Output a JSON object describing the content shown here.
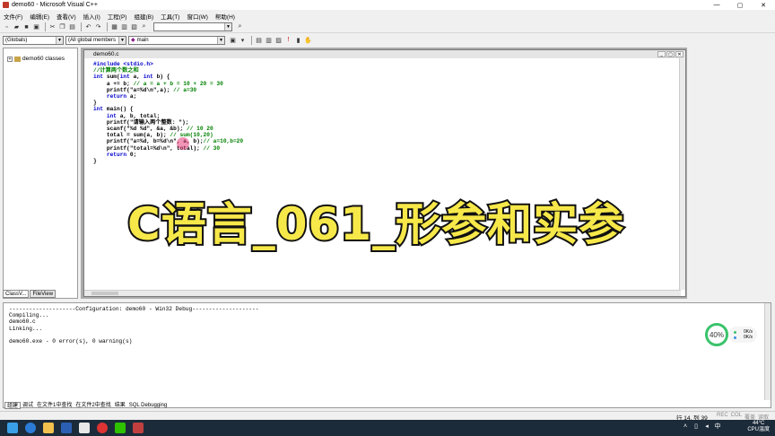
{
  "window": {
    "title": "demo60 - Microsoft Visual C++",
    "min": "—",
    "max": "▢",
    "close": "✕"
  },
  "menu": [
    "文件(F)",
    "编辑(E)",
    "查看(V)",
    "插入(I)",
    "工程(P)",
    "组建(B)",
    "工具(T)",
    "窗口(W)",
    "帮助(H)"
  ],
  "toolbar2": {
    "scope": "(Globals)",
    "members": "(All global members",
    "function": "main"
  },
  "leftpane": {
    "tree_root": "demo60 classes",
    "tabs": [
      "ClassV...",
      "FileView"
    ]
  },
  "editor": {
    "tab_title": "demo60.c",
    "lines": [
      [
        {
          "t": "#include <stdio.h>",
          "c": "kw"
        }
      ],
      [
        {
          "t": "//计算两个数之和",
          "c": "cm"
        }
      ],
      [
        {
          "t": "int ",
          "c": "kw"
        },
        {
          "t": "sum(",
          "c": "tx"
        },
        {
          "t": "int ",
          "c": "kw"
        },
        {
          "t": "a, ",
          "c": "tx"
        },
        {
          "t": "int ",
          "c": "kw"
        },
        {
          "t": "b) {",
          "c": "tx"
        }
      ],
      [
        {
          "t": "    a += b; ",
          "c": "tx"
        },
        {
          "t": "// a = a + b = 10 + 20 = 30",
          "c": "cm"
        }
      ],
      [
        {
          "t": "    printf(\"a=%d\\n\",a); ",
          "c": "tx"
        },
        {
          "t": "// a=30",
          "c": "cm"
        }
      ],
      [
        {
          "t": "    ",
          "c": "tx"
        },
        {
          "t": "return ",
          "c": "kw"
        },
        {
          "t": "a;",
          "c": "tx"
        }
      ],
      [
        {
          "t": "}",
          "c": "tx"
        }
      ],
      [
        {
          "t": "int ",
          "c": "kw"
        },
        {
          "t": "main() {",
          "c": "tx"
        }
      ],
      [
        {
          "t": "    ",
          "c": "tx"
        },
        {
          "t": "int ",
          "c": "kw"
        },
        {
          "t": "a, b, total;",
          "c": "tx"
        }
      ],
      [
        {
          "t": "    printf(\"请输入两个整数: \");",
          "c": "tx"
        }
      ],
      [
        {
          "t": "    scanf(\"%d %d\", &a, &b); ",
          "c": "tx"
        },
        {
          "t": "// 10 20",
          "c": "cm"
        }
      ],
      [
        {
          "t": "    total = sum(a, b); ",
          "c": "tx"
        },
        {
          "t": "// sum(10,20)",
          "c": "cm"
        }
      ],
      [
        {
          "t": "    printf(\"a=%d, b=%d\\n\", a, b);",
          "c": "tx"
        },
        {
          "t": "// a=10,b=20",
          "c": "cm"
        }
      ],
      [
        {
          "t": "    printf(\"total=%d\\n\", total); ",
          "c": "tx"
        },
        {
          "t": "// 30",
          "c": "cm"
        }
      ],
      [
        {
          "t": "    ",
          "c": "tx"
        },
        {
          "t": "return ",
          "c": "kw"
        },
        {
          "t": "0;",
          "c": "tx"
        }
      ],
      [
        {
          "t": "}",
          "c": "tx"
        }
      ]
    ]
  },
  "overlay_title": "C语言_061_形参和实参",
  "output": {
    "text": "--------------------Configuration: demo60 - Win32 Debug--------------------\nCompiling...\ndemo60.c\nLinking...\n\ndemo60.exe - 0 error(s), 0 warning(s)",
    "tabs": [
      "组建",
      "调试",
      "在文件1中查找",
      "在文件2中查找",
      "结果",
      "SQL Debugging"
    ]
  },
  "status": {
    "position": "行 14, 列 39",
    "flags": [
      "REC",
      "COL",
      "覆盖",
      "读取"
    ]
  },
  "gauge": {
    "value": "40%",
    "up": "0K/s",
    "down": "0K/s",
    "color": "#3bc36b"
  },
  "taskbar": {
    "temp": "44°C",
    "temp_label": "CPU温度"
  }
}
